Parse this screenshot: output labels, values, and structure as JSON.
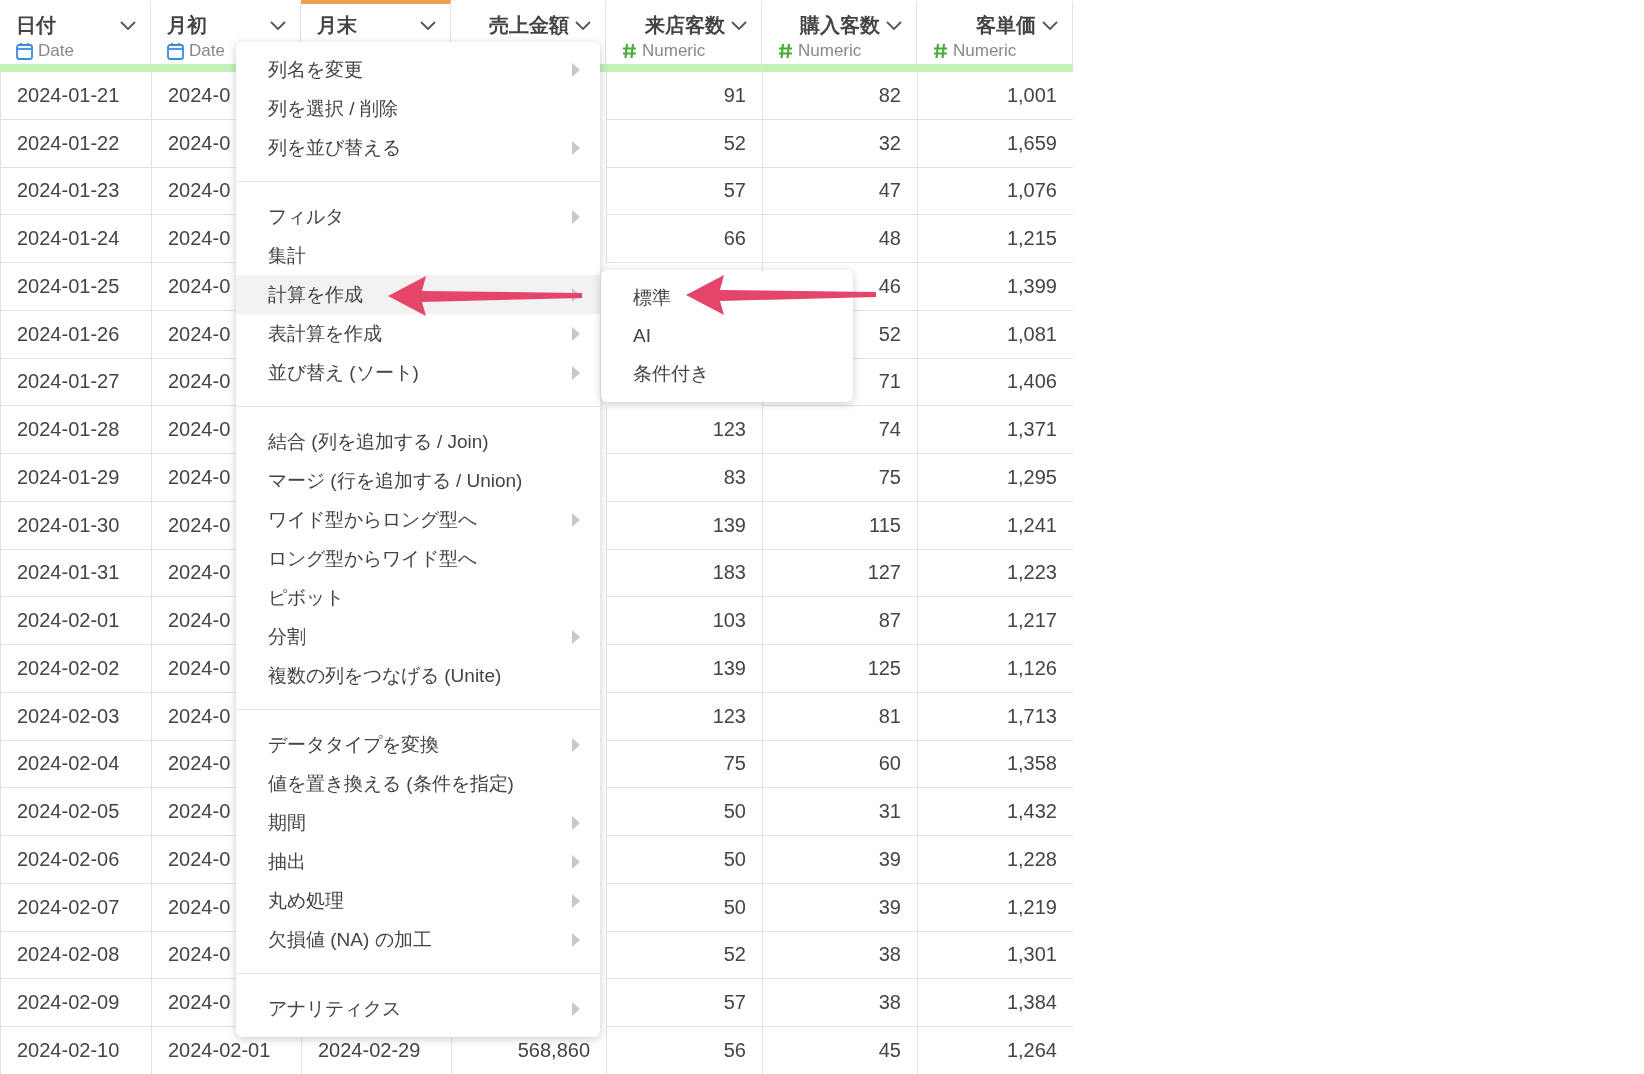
{
  "table": {
    "columns": [
      {
        "name": "日付",
        "type": "Date",
        "kind": "date",
        "selected": false
      },
      {
        "name": "月初",
        "type": "Date",
        "kind": "date",
        "selected": false
      },
      {
        "name": "月末",
        "kind": "date",
        "selected": true
      },
      {
        "name": "売上金額",
        "kind": "numeric",
        "selected": false
      },
      {
        "name": "来店客数",
        "type": "Numeric",
        "kind": "numeric",
        "selected": false
      },
      {
        "name": "購入客数",
        "type": "Numeric",
        "kind": "numeric",
        "selected": false
      },
      {
        "name": "客単価",
        "type": "Numeric",
        "kind": "numeric",
        "selected": false
      }
    ],
    "rows": [
      {
        "cells": [
          "2024-01-21",
          "2024-0",
          null,
          null,
          "91",
          "82",
          "1,001"
        ]
      },
      {
        "cells": [
          "2024-01-22",
          "2024-0",
          null,
          null,
          "52",
          "32",
          "1,659"
        ]
      },
      {
        "cells": [
          "2024-01-23",
          "2024-0",
          null,
          null,
          "57",
          "47",
          "1,076"
        ]
      },
      {
        "cells": [
          "2024-01-24",
          "2024-0",
          null,
          null,
          "66",
          "48",
          "1,215"
        ]
      },
      {
        "cells": [
          "2024-01-25",
          "2024-0",
          null,
          null,
          null,
          "46",
          "1,399"
        ]
      },
      {
        "cells": [
          "2024-01-26",
          "2024-0",
          null,
          null,
          null,
          "52",
          "1,081"
        ]
      },
      {
        "cells": [
          "2024-01-27",
          "2024-0",
          null,
          null,
          null,
          "71",
          "1,406"
        ]
      },
      {
        "cells": [
          "2024-01-28",
          "2024-0",
          null,
          null,
          "123",
          "74",
          "1,371"
        ]
      },
      {
        "cells": [
          "2024-01-29",
          "2024-0",
          null,
          null,
          "83",
          "75",
          "1,295"
        ]
      },
      {
        "cells": [
          "2024-01-30",
          "2024-0",
          null,
          null,
          "139",
          "115",
          "1,241"
        ]
      },
      {
        "cells": [
          "2024-01-31",
          "2024-0",
          null,
          null,
          "183",
          "127",
          "1,223"
        ]
      },
      {
        "cells": [
          "2024-02-01",
          "2024-0",
          null,
          null,
          "103",
          "87",
          "1,217"
        ]
      },
      {
        "cells": [
          "2024-02-02",
          "2024-0",
          null,
          null,
          "139",
          "125",
          "1,126"
        ]
      },
      {
        "cells": [
          "2024-02-03",
          "2024-0",
          null,
          null,
          "123",
          "81",
          "1,713"
        ]
      },
      {
        "cells": [
          "2024-02-04",
          "2024-0",
          null,
          null,
          "75",
          "60",
          "1,358"
        ]
      },
      {
        "cells": [
          "2024-02-05",
          "2024-0",
          null,
          null,
          "50",
          "31",
          "1,432"
        ]
      },
      {
        "cells": [
          "2024-02-06",
          "2024-0",
          null,
          null,
          "50",
          "39",
          "1,228"
        ]
      },
      {
        "cells": [
          "2024-02-07",
          "2024-0",
          null,
          null,
          "50",
          "39",
          "1,219"
        ]
      },
      {
        "cells": [
          "2024-02-08",
          "2024-0",
          null,
          null,
          "52",
          "38",
          "1,301"
        ]
      },
      {
        "cells": [
          "2024-02-09",
          "2024-0",
          null,
          null,
          "57",
          "38",
          "1,384"
        ]
      },
      {
        "cells": [
          "2024-02-10",
          "2024-02-01",
          "2024-02-29",
          "568,860",
          "56",
          "45",
          "1,264"
        ]
      }
    ]
  },
  "context_menu": {
    "groups": [
      [
        {
          "label": "列名を変更",
          "submenu": true,
          "selected": false
        },
        {
          "label": "列を選択 / 削除",
          "submenu": false,
          "selected": false
        },
        {
          "label": "列を並び替える",
          "submenu": true,
          "selected": false
        }
      ],
      [
        {
          "label": "フィルタ",
          "submenu": true,
          "selected": false
        },
        {
          "label": "集計",
          "submenu": false,
          "selected": false
        },
        {
          "label": "計算を作成",
          "submenu": true,
          "selected": true
        },
        {
          "label": "表計算を作成",
          "submenu": true,
          "selected": false
        },
        {
          "label": "並び替え (ソート)",
          "submenu": true,
          "selected": false
        }
      ],
      [
        {
          "label": "結合 (列を追加する / Join)",
          "submenu": false,
          "selected": false
        },
        {
          "label": "マージ (行を追加する / Union)",
          "submenu": false,
          "selected": false
        },
        {
          "label": "ワイド型からロング型へ",
          "submenu": true,
          "selected": false
        },
        {
          "label": "ロング型からワイド型へ",
          "submenu": false,
          "selected": false
        },
        {
          "label": "ピボット",
          "submenu": false,
          "selected": false
        },
        {
          "label": "分割",
          "submenu": true,
          "selected": false
        },
        {
          "label": "複数の列をつなげる (Unite)",
          "submenu": false,
          "selected": false
        }
      ],
      [
        {
          "label": "データタイプを変換",
          "submenu": true,
          "selected": false
        },
        {
          "label": "値を置き換える (条件を指定)",
          "submenu": false,
          "selected": false
        },
        {
          "label": "期間",
          "submenu": true,
          "selected": false
        },
        {
          "label": "抽出",
          "submenu": true,
          "selected": false
        },
        {
          "label": "丸め処理",
          "submenu": true,
          "selected": false
        },
        {
          "label": "欠損値 (NA) の加工",
          "submenu": true,
          "selected": false
        }
      ],
      [
        {
          "label": "アナリティクス",
          "submenu": true,
          "selected": false
        }
      ]
    ]
  },
  "submenu": {
    "items": [
      {
        "label": "標準",
        "selected": false
      },
      {
        "label": "AI",
        "selected": false
      },
      {
        "label": "条件付き",
        "selected": false
      }
    ]
  }
}
